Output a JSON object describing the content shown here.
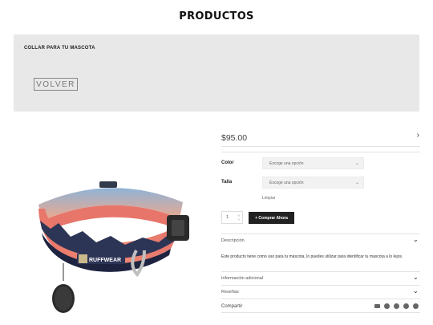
{
  "header": {
    "title": "PRODUCTOS"
  },
  "banner": {
    "title": "COLLAR PARA TU MASCOTA",
    "back_label": "VOLVER"
  },
  "product": {
    "price": "$95.00",
    "image_brand_text": "RUFFWEAR",
    "options": [
      {
        "label": "Color",
        "placeholder": "Escoge una opción"
      },
      {
        "label": "Talla",
        "placeholder": "Escoge una opción"
      }
    ],
    "clear_label": "Limpiar",
    "quantity": "1",
    "buy_label": "+ Comprar Ahora"
  },
  "accordion": {
    "description_title": "Descripción",
    "description_text": "Este producto tiene como uso para tu mascota, lo puedes utilizar para identificar tu mascota a lo lejos.",
    "additional_title": "Información adicional",
    "reviews_title": "Reseñas",
    "share_label": "Compartir"
  },
  "share_icons": [
    "mail-icon",
    "facebook-icon",
    "twitter-icon",
    "instagram-icon",
    "pinterest-icon"
  ],
  "colors": {
    "buy_button": "#222222",
    "banner_bg": "#e8e8e8",
    "collar_coral": "#e8756a",
    "collar_navy": "#2d3556"
  }
}
